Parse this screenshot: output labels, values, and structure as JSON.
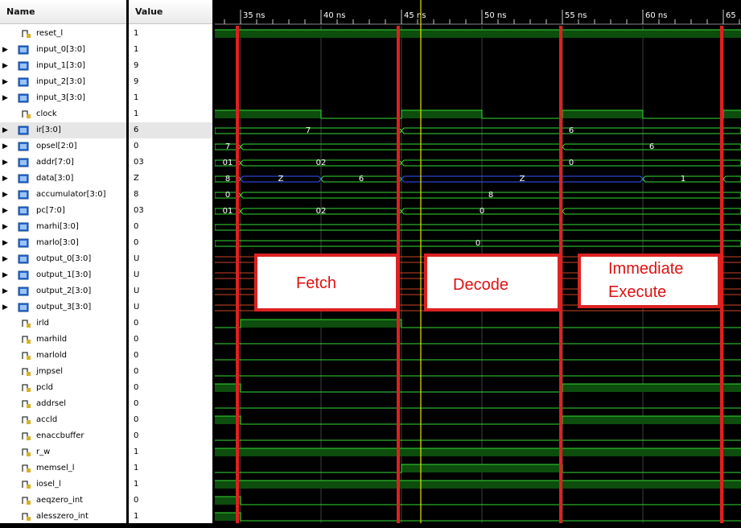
{
  "headers": {
    "name": "Name",
    "value": "Value"
  },
  "signals": [
    {
      "name": "reset_l",
      "value": "1",
      "kind": "bit"
    },
    {
      "name": "input_0[3:0]",
      "value": "1",
      "kind": "bus"
    },
    {
      "name": "input_1[3:0]",
      "value": "9",
      "kind": "bus"
    },
    {
      "name": "input_2[3:0]",
      "value": "9",
      "kind": "bus"
    },
    {
      "name": "input_3[3:0]",
      "value": "1",
      "kind": "bus"
    },
    {
      "name": "clock",
      "value": "1",
      "kind": "bit"
    },
    {
      "name": "ir[3:0]",
      "value": "6",
      "kind": "bus",
      "selected": true
    },
    {
      "name": "opsel[2:0]",
      "value": "0",
      "kind": "bus"
    },
    {
      "name": "addr[7:0]",
      "value": "03",
      "kind": "bus"
    },
    {
      "name": "data[3:0]",
      "value": "Z",
      "kind": "bus"
    },
    {
      "name": "accumulator[3:0]",
      "value": "8",
      "kind": "bus"
    },
    {
      "name": "pc[7:0]",
      "value": "03",
      "kind": "bus"
    },
    {
      "name": "marhi[3:0]",
      "value": "0",
      "kind": "bus"
    },
    {
      "name": "marlo[3:0]",
      "value": "0",
      "kind": "bus"
    },
    {
      "name": "output_0[3:0]",
      "value": "U",
      "kind": "bus"
    },
    {
      "name": "output_1[3:0]",
      "value": "U",
      "kind": "bus"
    },
    {
      "name": "output_2[3:0]",
      "value": "U",
      "kind": "bus"
    },
    {
      "name": "output_3[3:0]",
      "value": "U",
      "kind": "bus"
    },
    {
      "name": "irld",
      "value": "0",
      "kind": "bit"
    },
    {
      "name": "marhild",
      "value": "0",
      "kind": "bit"
    },
    {
      "name": "marlold",
      "value": "0",
      "kind": "bit"
    },
    {
      "name": "jmpsel",
      "value": "0",
      "kind": "bit"
    },
    {
      "name": "pcld",
      "value": "0",
      "kind": "bit"
    },
    {
      "name": "addrsel",
      "value": "0",
      "kind": "bit"
    },
    {
      "name": "accld",
      "value": "0",
      "kind": "bit"
    },
    {
      "name": "enaccbuffer",
      "value": "0",
      "kind": "bit"
    },
    {
      "name": "r_w",
      "value": "1",
      "kind": "bit"
    },
    {
      "name": "memsel_l",
      "value": "1",
      "kind": "bit"
    },
    {
      "name": "iosel_l",
      "value": "1",
      "kind": "bit"
    },
    {
      "name": "aeqzero_int",
      "value": "0",
      "kind": "bit"
    },
    {
      "name": "alesszero_int",
      "value": "1",
      "kind": "bit"
    }
  ],
  "timeline": {
    "unit": "ns",
    "labels": [
      "35 ns",
      "40 ns",
      "45 ns",
      "50 ns",
      "55 ns",
      "60 ns",
      "65"
    ],
    "label_times": [
      35,
      40,
      45,
      50,
      55,
      60,
      65
    ],
    "view_start": 33.4,
    "view_end": 66.1,
    "cursor_time": 46.2,
    "marker_times": [
      34.8,
      44.8,
      54.9,
      64.9
    ]
  },
  "bus_data": {
    "ir[3:0]": [
      [
        33.4,
        45.0,
        "7"
      ],
      [
        45.0,
        66.1,
        "6"
      ]
    ],
    "opsel[2:0]": [
      [
        33.4,
        35.0,
        "7"
      ],
      [
        35.0,
        55.0,
        ""
      ],
      [
        55.0,
        66.1,
        "6"
      ]
    ],
    "addr[7:0]": [
      [
        33.4,
        35.0,
        "01"
      ],
      [
        35.0,
        45.0,
        "02"
      ],
      [
        45.0,
        66.1,
        "0"
      ]
    ],
    "data[3:0]": [
      [
        33.4,
        35.0,
        "8"
      ],
      [
        35.0,
        40.0,
        "Z"
      ],
      [
        40.0,
        45.0,
        "6"
      ],
      [
        45.0,
        60.0,
        "Z"
      ],
      [
        60.0,
        65.0,
        "1"
      ],
      [
        65.0,
        66.1,
        ""
      ]
    ],
    "accumulator[3:0]": [
      [
        33.4,
        35.0,
        "0"
      ],
      [
        35.0,
        66.1,
        "8"
      ]
    ],
    "pc[7:0]": [
      [
        33.4,
        35.0,
        "01"
      ],
      [
        35.0,
        45.0,
        "02"
      ],
      [
        45.0,
        55.0,
        "0"
      ],
      [
        55.0,
        66.1,
        ""
      ]
    ],
    "marhi[3:0]": [
      [
        33.4,
        66.1,
        ""
      ]
    ],
    "marlo[3:0]": [
      [
        33.4,
        66.1,
        "0"
      ]
    ]
  },
  "bit_data": {
    "reset_l": [
      [
        33.4,
        1
      ]
    ],
    "clock": [
      [
        33.4,
        1
      ],
      [
        40.0,
        0
      ],
      [
        45.0,
        1
      ],
      [
        50.0,
        0
      ],
      [
        55.0,
        1
      ],
      [
        60.0,
        0
      ],
      [
        65.0,
        1
      ]
    ],
    "irld": [
      [
        33.4,
        0
      ],
      [
        35.0,
        1
      ],
      [
        45.0,
        0
      ]
    ],
    "marhild": [
      [
        33.4,
        0
      ]
    ],
    "marlold": [
      [
        33.4,
        0
      ]
    ],
    "jmpsel": [
      [
        33.4,
        0
      ]
    ],
    "pcld": [
      [
        33.4,
        1
      ],
      [
        35.0,
        0
      ],
      [
        55.0,
        1
      ]
    ],
    "addrsel": [
      [
        33.4,
        0
      ]
    ],
    "accld": [
      [
        33.4,
        1
      ],
      [
        35.0,
        0
      ],
      [
        55.0,
        1
      ]
    ],
    "enaccbuffer": [
      [
        33.4,
        0
      ]
    ],
    "r_w": [
      [
        33.4,
        1
      ]
    ],
    "memsel_l": [
      [
        33.4,
        0
      ],
      [
        45.0,
        1
      ],
      [
        55.0,
        0
      ]
    ],
    "iosel_l": [
      [
        33.4,
        1
      ]
    ],
    "aeqzero_int": [
      [
        33.4,
        1
      ],
      [
        35.0,
        0
      ]
    ],
    "alesszero_int": [
      [
        33.4,
        1
      ],
      [
        35.0,
        0
      ]
    ]
  },
  "undefined_buses": [
    "output_0[3:0]",
    "output_1[3:0]",
    "output_2[3:0]",
    "output_3[3:0]"
  ],
  "annotations": [
    {
      "lines": [
        "Fetch"
      ]
    },
    {
      "lines": [
        "Decode"
      ]
    },
    {
      "lines": [
        "Immediate",
        "Execute"
      ]
    }
  ],
  "colors": {
    "bit_line": "#33dd33",
    "bit_fill": "#0d4d0d",
    "bus_line": "#33dd33",
    "hiz_line": "#3355ff",
    "undef_line": "#cc4422",
    "marker": "#e02020",
    "cursor": "#e6e600",
    "grid": "#404040",
    "timeline_text": "#ffffff"
  }
}
